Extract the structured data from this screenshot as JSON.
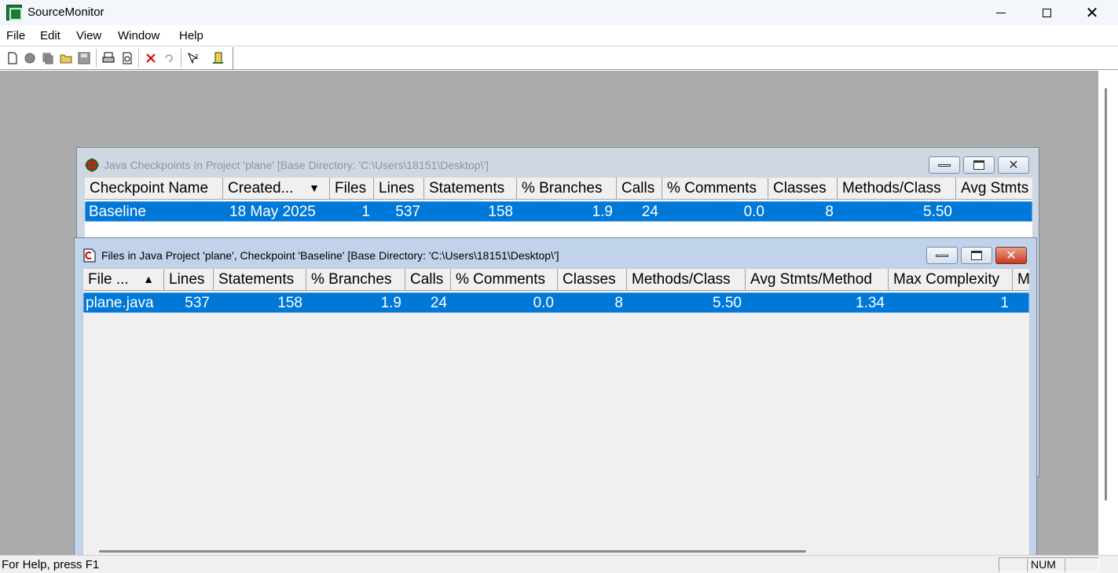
{
  "app": {
    "title": "SourceMonitor"
  },
  "menu": [
    "File",
    "Edit",
    "View",
    "Window",
    "Help"
  ],
  "toolbar": {
    "buttons": [
      "new-icon",
      "gear-icon",
      "copy-icon",
      "open-folder-icon",
      "save-icon",
      "print-icon",
      "print-preview-icon",
      "delete-icon",
      "undo-icon",
      "help-icon",
      "exit-icon"
    ]
  },
  "checkpoints_window": {
    "title": "Java Checkpoints In Project 'plane'  [Base Directory: 'C:\\Users\\18151\\Desktop\\']",
    "columns": [
      "Checkpoint Name",
      "Created...",
      "Files",
      "Lines",
      "Statements",
      "% Branches",
      "Calls",
      "% Comments",
      "Classes",
      "Methods/Class",
      "Avg Stmts"
    ],
    "rows": [
      [
        "Baseline",
        "18 May 2025",
        "1",
        "537",
        "158",
        "1.9",
        "24",
        "0.0",
        "8",
        "5.50",
        ""
      ]
    ]
  },
  "files_window": {
    "title": "Files in Java Project 'plane', Checkpoint 'Baseline'  [Base Directory: 'C:\\Users\\18151\\Desktop\\']",
    "columns": [
      "File ...",
      "Lines",
      "Statements",
      "% Branches",
      "Calls",
      "% Comments",
      "Classes",
      "Methods/Class",
      "Avg Stmts/Method",
      "Max Complexity",
      "M"
    ],
    "rows": [
      [
        "plane.java",
        "537",
        "158",
        "1.9",
        "24",
        "0.0",
        "8",
        "5.50",
        "1.34",
        "1",
        ""
      ]
    ]
  },
  "status": {
    "help_text": "For Help, press F1",
    "num": "NUM"
  },
  "colors": {
    "selection": "#0078d7",
    "mdi_background": "#ababab"
  }
}
